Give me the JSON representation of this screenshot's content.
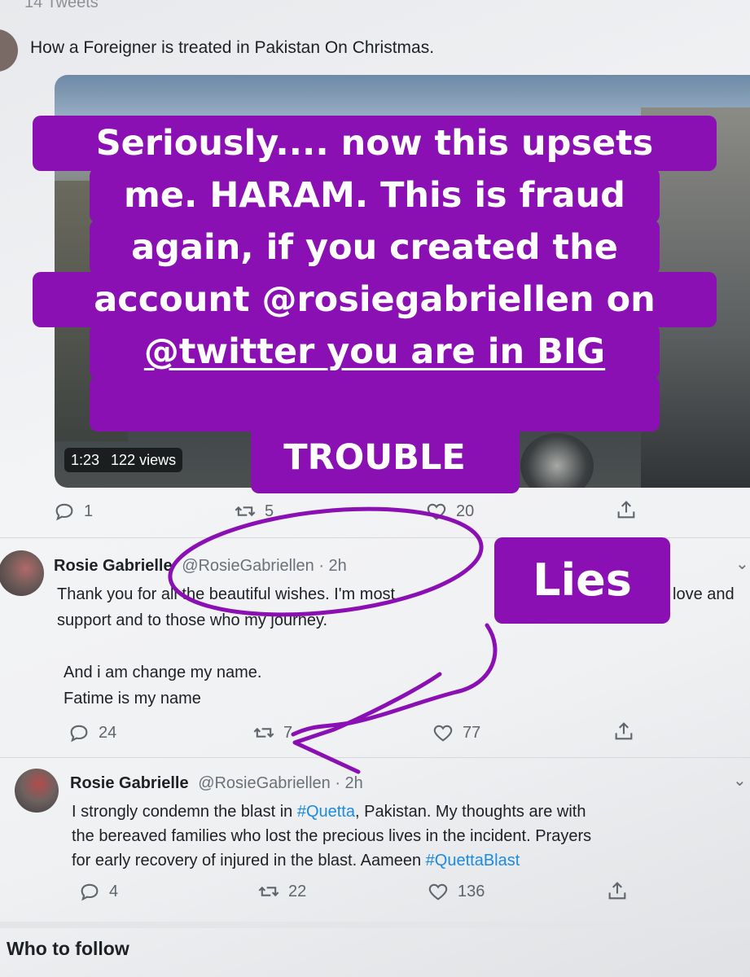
{
  "header": {
    "tweet_count": "14 Tweets"
  },
  "pinned_tweet": {
    "text": "How a Foreigner is treated in Pakistan On Christmas.",
    "video": {
      "duration": "1:23",
      "views": "122 views"
    },
    "stats": {
      "replies": "1",
      "retweets": "5",
      "likes": "20"
    }
  },
  "overlay_main": {
    "lines": [
      "Seriously.... now this upsets",
      "me. HARAM. This is fraud",
      "again, if you created the",
      "account @rosiegabriellen on",
      "@twitter  you are in BIG",
      "TROUBLE"
    ]
  },
  "overlay_lies": {
    "text": "Lies"
  },
  "tweet2": {
    "name": "Rosie Gabrielle",
    "handle": "@RosieGabriellen · 2h",
    "line1": "Thank you for all the beautiful wishes. I'm most",
    "line1_end": "love and",
    "line2": "support and to those who my journey.",
    "line3": "And i am change my name.",
    "line4": "Fatime is my name",
    "stats": {
      "replies": "24",
      "retweets": "7",
      "likes": "77"
    }
  },
  "tweet3": {
    "name": "Rosie Gabrielle",
    "handle": "@RosieGabriellen · 2h",
    "line1_pre": "I strongly condemn the blast in ",
    "line1_tag": "#Quetta",
    "line1_post": ", Pakistan. My thoughts are with",
    "line2": "the bereaved families who lost the precious lives in the incident. Prayers",
    "line3_pre": "for early recovery of injured in the blast. Aameen ",
    "line3_tag": "#QuettaBlast",
    "stats": {
      "replies": "4",
      "retweets": "22",
      "likes": "136"
    }
  },
  "who_to_follow": {
    "title": "Who to follow"
  },
  "colors": {
    "overlay_purple": "#8a10b3",
    "link_blue": "#1b8ae0"
  }
}
